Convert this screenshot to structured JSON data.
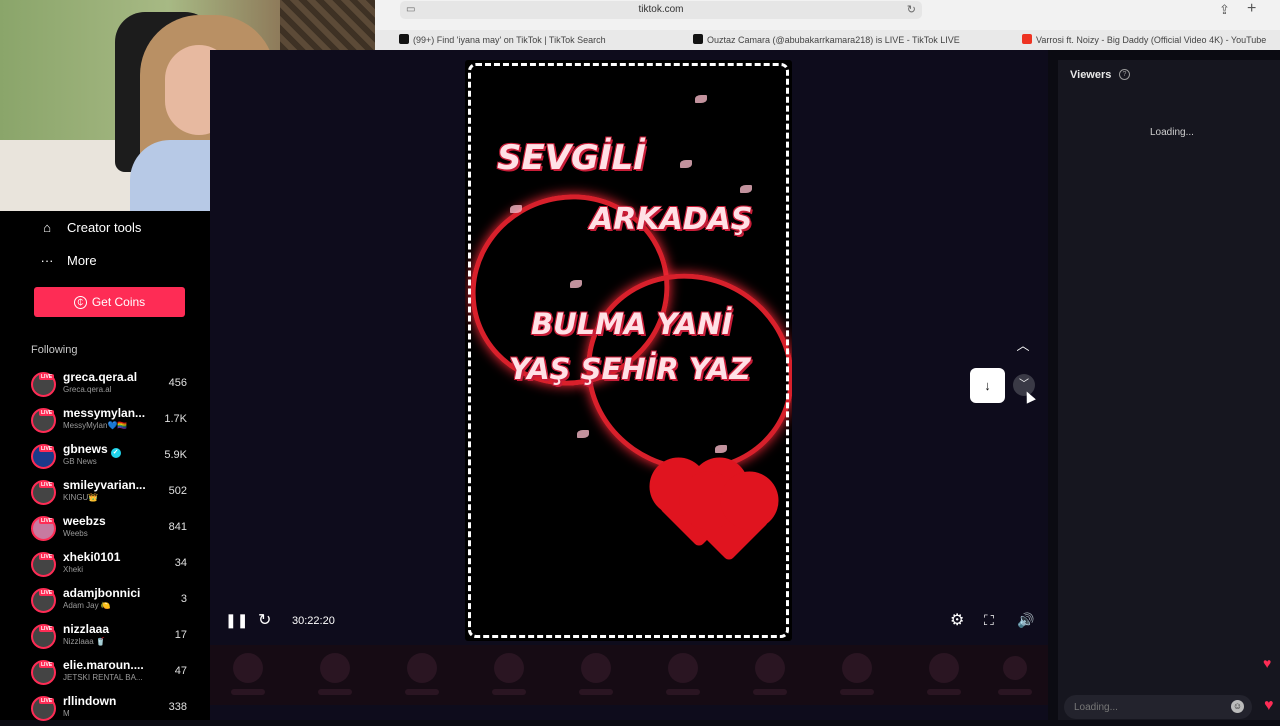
{
  "browser": {
    "url": "tiktok.com",
    "tabs": [
      {
        "label": "(99+) Find 'iyana may' on TikTok | TikTok Search",
        "favicon": "tiktok-icon"
      },
      {
        "label": "Ouztaz Camara (@abubakarrkamara218) is LIVE - TikTok LIVE",
        "favicon": "tiktok-icon"
      },
      {
        "label": "Varrosi ft. Noizy - Big Daddy (Official Video 4K) - YouTube",
        "favicon": "youtube-icon"
      }
    ]
  },
  "sidebar": {
    "menu": [
      {
        "label": "Creator tools",
        "icon": "home-icon"
      },
      {
        "label": "More",
        "icon": "more-icon"
      }
    ],
    "coins_button": "Get Coins",
    "following_title": "Following",
    "following": [
      {
        "name": "greca.qera.al",
        "sub": "Greca.qera.al",
        "count": "456"
      },
      {
        "name": "messymylan...",
        "sub": "MessyMylan💙🏳️‍🌈",
        "count": "1.7K"
      },
      {
        "name": "gbnews",
        "sub": "GB News",
        "count": "5.9K",
        "verified": true
      },
      {
        "name": "smileyvarian...",
        "sub": "KINGU👑",
        "count": "502"
      },
      {
        "name": "weebzs",
        "sub": "Weebs",
        "count": "841"
      },
      {
        "name": "xheki0101",
        "sub": "Xheki",
        "count": "34"
      },
      {
        "name": "adamjbonnici",
        "sub": "Adam Jay 🍋",
        "count": "3"
      },
      {
        "name": "nizzlaaa",
        "sub": "Nizzlaaa 🥤",
        "count": "17"
      },
      {
        "name": "elie.maroun....",
        "sub": "JETSKI RENTAL BA...",
        "count": "47"
      },
      {
        "name": "rllindown",
        "sub": "M",
        "count": "338"
      }
    ]
  },
  "video": {
    "line1": "SEVGİLİ",
    "line2": "ARKADAŞ",
    "line3": "BULMA YANİ",
    "line4": "YAŞ ŞEHİR YAZ"
  },
  "controls": {
    "time": "30:22:20"
  },
  "viewers": {
    "title": "Viewers",
    "loading": "Loading...",
    "chat_placeholder": "Loading..."
  },
  "colors": {
    "accent": "#fe2c55",
    "sidebar_bg": "#000000",
    "player_bg": "#0e0c1c"
  }
}
